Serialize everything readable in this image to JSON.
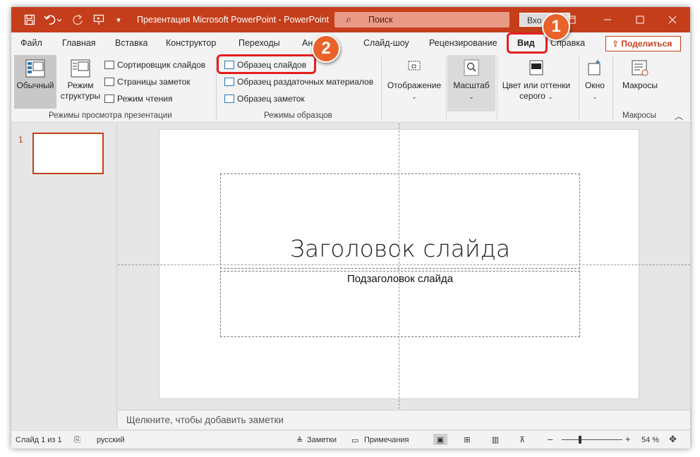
{
  "titlebar": {
    "doc_title": "Презентация Microsoft PowerPoint  -  PowerPoint",
    "search_placeholder": "Поиск",
    "signin": "Вхо",
    "icons": [
      "save-icon",
      "undo-icon",
      "redo-icon",
      "start-from-beginning-icon",
      "customize-qat-icon",
      "minimize-icon",
      "maximize-icon",
      "close-icon"
    ]
  },
  "tabs": [
    {
      "label": "Файл"
    },
    {
      "label": "Главная"
    },
    {
      "label": "Вставка"
    },
    {
      "label": "Конструктор"
    },
    {
      "label": "Переходы"
    },
    {
      "label": "Ан"
    },
    {
      "label": "Слайд-шоу"
    },
    {
      "label": "Рецензирование"
    },
    {
      "label": "Вид",
      "active": true
    },
    {
      "label": "Справка"
    }
  ],
  "share_label": "Поделиться",
  "ribbon": {
    "presentation_views": {
      "label": "Режимы просмотра презентации",
      "normal": "Обычный",
      "outline_line1": "Режим",
      "outline_line2": "структуры",
      "sorter": "Сортировщик слайдов",
      "notes_page": "Страницы заметок",
      "reading": "Режим чтения"
    },
    "master_views": {
      "label": "Режимы образцов",
      "slide_master": "Образец слайдов",
      "handout_master": "Образец раздаточных материалов",
      "notes_master": "Образец заметок"
    },
    "show": "Отображение",
    "zoom": "Масштаб",
    "color_line1": "Цвет или оттенки",
    "color_line2": "серого",
    "window": "Окно",
    "macros": "Макросы",
    "macros_group_label": "Макросы"
  },
  "badges": {
    "one": "1",
    "two": "2"
  },
  "thumbnail_number": "1",
  "slide": {
    "title": "Заголовок слайда",
    "subtitle": "Подзаголовок слайда"
  },
  "notes_placeholder": "Щелкните, чтобы добавить заметки",
  "status": {
    "slide_info": "Слайд 1 из 1",
    "language": "русский",
    "notes": "Заметки",
    "comments": "Примечания",
    "zoom_minus": "–",
    "zoom_plus": "+",
    "zoom_pct": "54 %",
    "zoom_fraction": 0.3
  },
  "colors": {
    "accent": "#c43e1c",
    "highlight": "#e41f1f",
    "badge": "#e8622a"
  }
}
